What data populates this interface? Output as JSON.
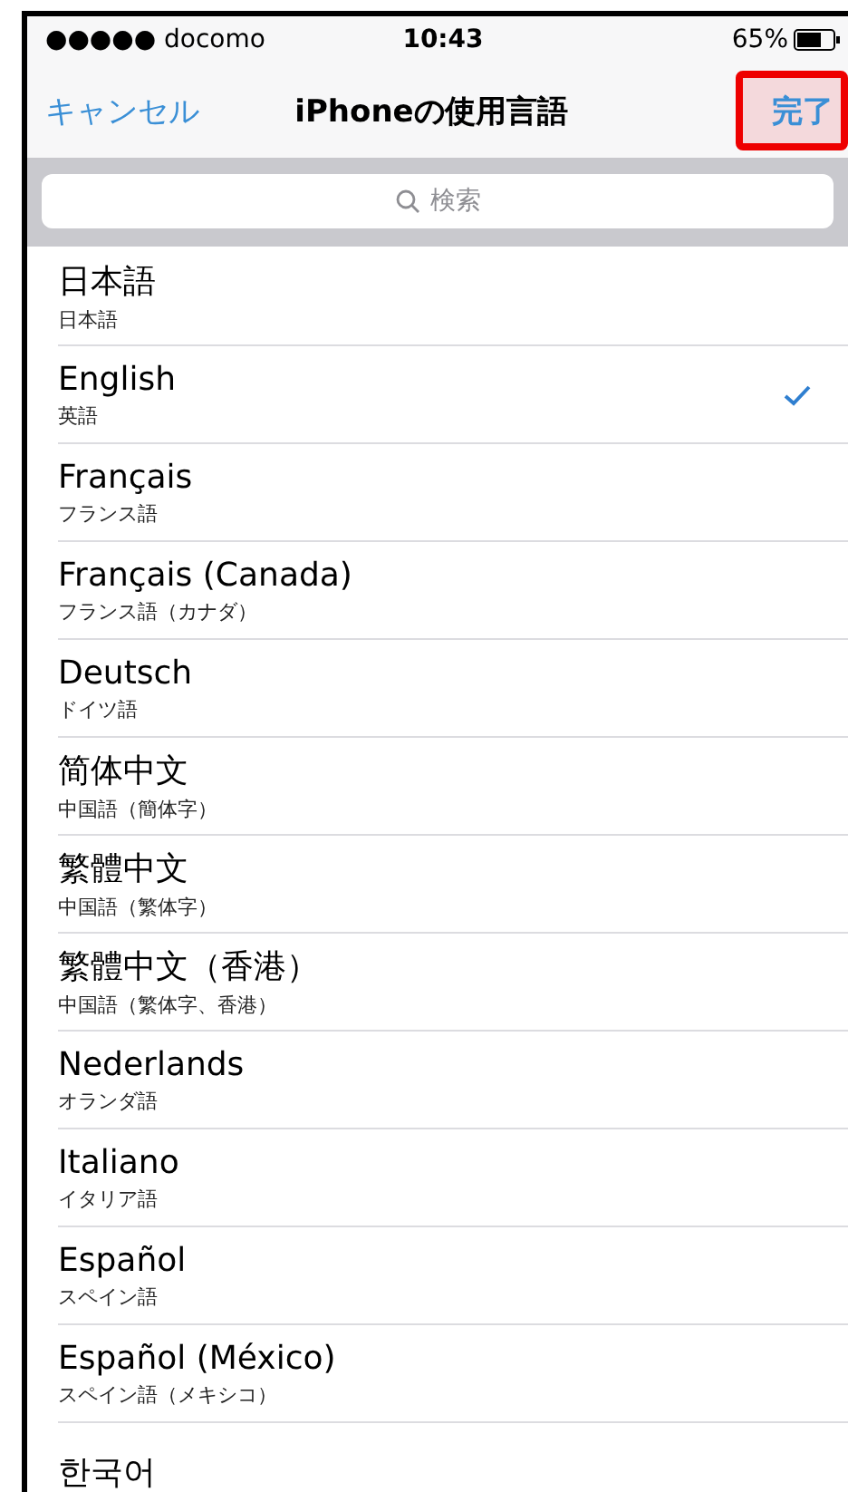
{
  "status_bar": {
    "carrier": "●●●●● docomo",
    "time": "10:43",
    "battery": "65%"
  },
  "nav": {
    "cancel": "キャンセル",
    "title": "iPhoneの使用言語",
    "done": {
      "label": "完了",
      "highlighted": true
    }
  },
  "search": {
    "placeholder": "検索"
  },
  "languages": [
    {
      "name": "日本語",
      "subtitle": "日本語",
      "selected": false
    },
    {
      "name": "English",
      "subtitle": "英語",
      "selected": true
    },
    {
      "name": "Français",
      "subtitle": "フランス語",
      "selected": false
    },
    {
      "name": "Français (Canada)",
      "subtitle": "フランス語（カナダ）",
      "selected": false
    },
    {
      "name": "Deutsch",
      "subtitle": "ドイツ語",
      "selected": false
    },
    {
      "name": "简体中文",
      "subtitle": "中国語（簡体字）",
      "selected": false
    },
    {
      "name": "繁體中文",
      "subtitle": "中国語（繁体字）",
      "selected": false
    },
    {
      "name": "繁體中文（香港）",
      "subtitle": "中国語（繁体字、香港）",
      "selected": false
    },
    {
      "name": "Nederlands",
      "subtitle": "オランダ語",
      "selected": false
    },
    {
      "name": "Italiano",
      "subtitle": "イタリア語",
      "selected": false
    },
    {
      "name": "Español",
      "subtitle": "スペイン語",
      "selected": false
    },
    {
      "name": "Español (México)",
      "subtitle": "スペイン語（メキシコ）",
      "selected": false
    },
    {
      "name": "한국어",
      "selected": false
    }
  ]
}
